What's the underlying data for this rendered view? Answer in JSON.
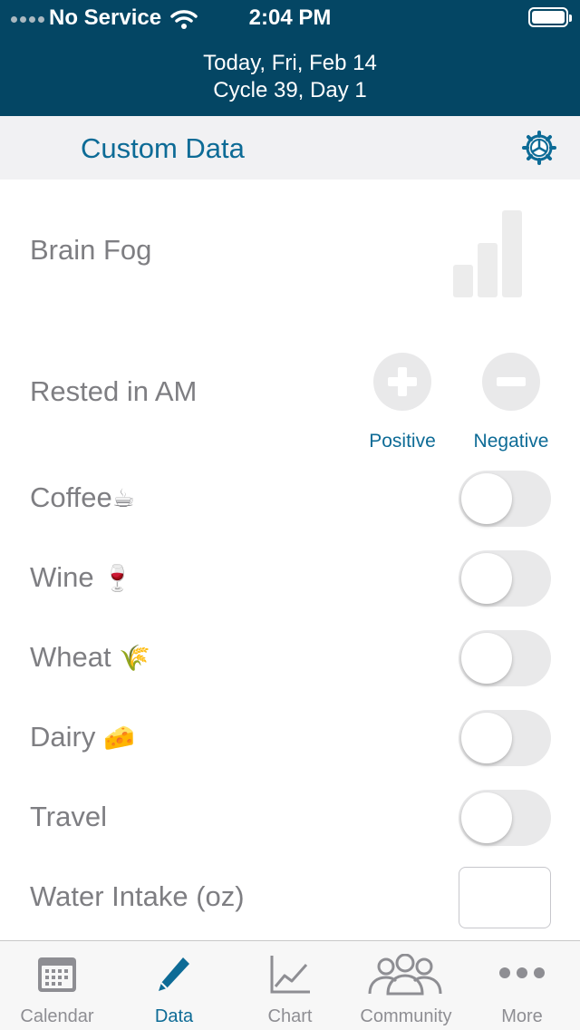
{
  "status_bar": {
    "carrier": "No Service",
    "time": "2:04 PM"
  },
  "header": {
    "date_line": "Today, Fri, Feb 14",
    "cycle_line": "Cycle 39, Day 1"
  },
  "section": {
    "title": "Custom Data",
    "settings_icon": "gear-icon"
  },
  "rows": {
    "brain_fog": {
      "label": "Brain Fog",
      "icon": "bar-chart-icon"
    },
    "rested": {
      "label": "Rested in AM",
      "positive_label": "Positive",
      "negative_label": "Negative"
    },
    "coffee": {
      "label": "Coffee",
      "emoji": "☕"
    },
    "wine": {
      "label": "Wine",
      "emoji": "🍷"
    },
    "wheat": {
      "label": "Wheat",
      "emoji": "🌾"
    },
    "dairy": {
      "label": "Dairy",
      "emoji": "🧀"
    },
    "travel": {
      "label": "Travel"
    },
    "water": {
      "label": "Water Intake (oz)",
      "value": ""
    }
  },
  "tabs": [
    {
      "label": "Calendar",
      "icon": "calendar-icon"
    },
    {
      "label": "Data",
      "icon": "pencil-icon"
    },
    {
      "label": "Chart",
      "icon": "line-chart-icon"
    },
    {
      "label": "Community",
      "icon": "people-icon"
    },
    {
      "label": "More",
      "icon": "more-dots-icon"
    }
  ],
  "colors": {
    "header_bg": "#044664",
    "accent": "#0d6b96",
    "label_gray": "#7e7e82",
    "toggle_off": "#e9e9ea"
  }
}
